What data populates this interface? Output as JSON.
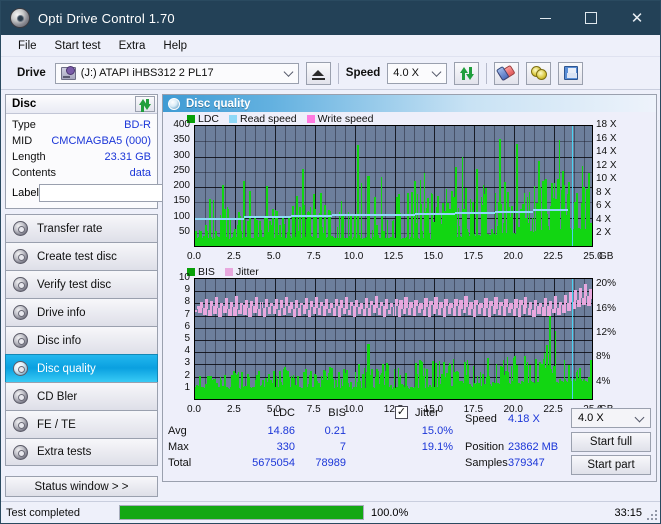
{
  "window": {
    "title": "Opti Drive Control 1.70",
    "icon": "disc-icon",
    "controls": {
      "minimize": "–",
      "maximize": "□",
      "close": "✕"
    }
  },
  "menu": {
    "items": [
      "File",
      "Start test",
      "Extra",
      "Help"
    ]
  },
  "toolbar": {
    "drive_label": "Drive",
    "drive_value": "(J:)   ATAPI iHBS312   2 PL17",
    "eject_icon": "eject-icon",
    "speed_label": "Speed",
    "speed_value": "4.0 X",
    "refresh_icon": "refresh-icon",
    "erase_icon": "eraser-icon",
    "discs_icon": "two-discs-icon",
    "save_icon": "floppy-save-icon"
  },
  "disc_panel": {
    "title": "Disc",
    "refresh_icon": "refresh-icon",
    "rows": [
      {
        "key": "Type",
        "value": "BD-R"
      },
      {
        "key": "MID",
        "value": "CMCMAGBA5 (000)"
      },
      {
        "key": "Length",
        "value": "23.31 GB"
      },
      {
        "key": "Contents",
        "value": "data"
      }
    ],
    "label_key": "Label",
    "label_value": "",
    "label_placeholder": "",
    "label_icon": "disc-label-icon"
  },
  "nav": {
    "items": [
      {
        "label": "Transfer rate",
        "selected": false
      },
      {
        "label": "Create test disc",
        "selected": false
      },
      {
        "label": "Verify test disc",
        "selected": false
      },
      {
        "label": "Drive info",
        "selected": false
      },
      {
        "label": "Disc info",
        "selected": false
      },
      {
        "label": "Disc quality",
        "selected": true
      },
      {
        "label": "CD Bler",
        "selected": false
      },
      {
        "label": "FE / TE",
        "selected": false
      },
      {
        "label": "Extra tests",
        "selected": false
      }
    ],
    "status_window": "Status window > >"
  },
  "main": {
    "header_title": "Disc quality",
    "header_icon": "disc-quality-icon"
  },
  "stats": {
    "col_headers": [
      "LDC",
      "BIS"
    ],
    "jitter_label": "Jitter",
    "jitter_checked": true,
    "rows": [
      {
        "name": "Avg",
        "ldc": "14.86",
        "bis": "0.21",
        "jitter": "15.0%"
      },
      {
        "name": "Max",
        "ldc": "330",
        "bis": "7",
        "jitter": "19.1%"
      },
      {
        "name": "Total",
        "ldc": "5675054",
        "bis": "78989",
        "jitter": ""
      }
    ],
    "speed_label": "Speed",
    "speed_value": "4.18 X",
    "position_label": "Position",
    "position_value": "23862 MB",
    "samples_label": "Samples",
    "samples_value": "379347",
    "speed_select": "4.0 X",
    "start_full": "Start full",
    "start_part": "Start part"
  },
  "statusbar": {
    "text": "Test completed",
    "percent": "100.0%",
    "progress": 100,
    "elapsed": "33:15",
    "progress_color": "#14a814"
  },
  "chart_data": [
    {
      "id": "top",
      "type": "bar",
      "title": "LDC / Read speed",
      "legend": [
        {
          "label": "LDC",
          "color": "#08a008"
        },
        {
          "label": "Read speed",
          "color": "#8fd8f7"
        },
        {
          "label": "Write speed",
          "color": "#ff7ae0"
        }
      ],
      "xlabel": "GB",
      "ylabel": "LDC",
      "y2label": "X",
      "xlim": [
        0,
        25.0
      ],
      "ylim": [
        0,
        400
      ],
      "y2lim": [
        0,
        18
      ],
      "xticks": [
        "0.0",
        "2.5",
        "5.0",
        "7.5",
        "10.0",
        "12.5",
        "15.0",
        "17.5",
        "20.0",
        "22.5",
        "25.0"
      ],
      "yticks": [
        "400",
        "350",
        "300",
        "250",
        "200",
        "150",
        "100",
        "50"
      ],
      "y2ticks": [
        "18 X",
        "16 X",
        "14 X",
        "12 X",
        "10 X",
        "8 X",
        "6 X",
        "4 X",
        "2 X"
      ],
      "x_unit_label": "GB",
      "grid": true,
      "series": [
        {
          "name": "LDC",
          "color": "#12d612",
          "baseline": [
            28,
            26,
            30,
            24,
            27,
            25,
            70,
            29,
            26,
            31,
            24,
            27,
            26,
            34,
            28,
            26,
            25,
            27,
            120,
            28,
            26,
            24,
            27,
            30,
            26,
            25,
            28,
            26,
            24,
            27,
            26,
            29,
            26,
            24,
            28,
            26,
            25,
            27,
            26,
            28,
            24,
            26,
            29,
            26,
            25,
            27,
            26,
            24,
            28,
            26,
            27,
            25,
            26,
            28,
            24,
            27,
            26,
            25,
            100,
            27,
            26,
            24,
            28,
            26,
            25,
            27,
            26,
            24,
            28,
            26,
            27,
            25,
            26,
            28,
            24,
            27,
            26,
            25,
            28,
            26,
            24,
            27,
            26,
            29,
            26,
            24,
            28,
            26,
            25,
            27,
            26,
            24,
            28,
            26,
            27,
            25,
            26,
            28,
            24,
            27,
            26,
            25,
            28,
            26,
            24,
            27,
            26,
            29,
            230,
            26,
            24,
            28,
            26,
            25,
            27,
            26,
            24,
            28,
            26,
            27,
            25,
            26,
            28,
            24,
            27,
            26,
            25,
            28,
            26,
            24,
            27,
            26,
            29,
            26,
            24,
            28,
            26,
            25,
            27,
            26,
            24,
            28,
            26,
            27,
            25,
            26,
            28,
            24,
            27,
            26,
            25,
            28,
            26,
            24,
            27,
            26,
            29,
            26,
            24,
            28,
            30,
            28,
            32,
            30,
            28,
            34,
            30,
            28,
            36,
            32,
            30,
            34,
            32,
            30,
            38,
            34,
            32,
            36,
            34,
            32,
            40,
            36,
            34,
            38,
            36,
            34,
            42,
            38,
            36,
            40,
            38,
            36,
            44,
            40,
            38,
            42,
            40,
            38,
            46,
            42,
            40,
            44,
            42,
            40,
            48,
            44,
            42,
            46,
            44,
            42,
            50,
            46,
            44,
            48,
            46,
            44,
            52,
            48,
            46,
            50,
            48,
            46,
            54,
            50,
            48,
            52,
            50,
            48,
            56,
            52,
            50,
            54,
            52,
            50,
            58,
            54,
            52,
            56,
            54,
            52,
            60,
            56,
            54,
            58,
            56,
            54,
            62,
            58,
            56,
            60
          ]
        },
        {
          "name": "Read speed",
          "color": "#8fd8f7",
          "steps": [
            {
              "x0": 0.0,
              "x1": 3.1,
              "v": 3.9
            },
            {
              "x0": 3.1,
              "x1": 6.0,
              "v": 4.1
            },
            {
              "x0": 6.0,
              "x1": 8.6,
              "v": 4.25
            },
            {
              "x0": 8.6,
              "x1": 11.2,
              "v": 4.4
            },
            {
              "x0": 11.2,
              "x1": 13.8,
              "v": 4.5
            },
            {
              "x0": 13.8,
              "x1": 16.3,
              "v": 4.6
            },
            {
              "x0": 16.3,
              "x1": 18.8,
              "v": 4.75
            },
            {
              "x0": 18.8,
              "x1": 21.2,
              "v": 4.9
            },
            {
              "x0": 21.2,
              "x1": 23.4,
              "v": 5.1
            }
          ]
        }
      ],
      "marker_line": {
        "x": 23.65,
        "color": "#49d3f2"
      }
    },
    {
      "id": "bottom",
      "type": "bar",
      "title": "BIS / Jitter",
      "legend": [
        {
          "label": "BIS",
          "color": "#08a008"
        },
        {
          "label": "Jitter",
          "color": "#e8a8de"
        }
      ],
      "xlabel": "GB",
      "ylabel": "BIS",
      "y2label": "%",
      "xlim": [
        0,
        25.0
      ],
      "ylim": [
        0,
        10
      ],
      "y2lim": [
        0,
        20
      ],
      "xticks": [
        "0.0",
        "2.5",
        "5.0",
        "7.5",
        "10.0",
        "12.5",
        "15.0",
        "17.5",
        "20.0",
        "22.5",
        "25.0"
      ],
      "yticks": [
        "10",
        "9",
        "8",
        "7",
        "6",
        "5",
        "4",
        "3",
        "2",
        "1"
      ],
      "y2ticks": [
        "20%",
        "16%",
        "12%",
        "8%",
        "4%"
      ],
      "x_unit_label": "GB",
      "grid": true,
      "series": [
        {
          "name": "BIS",
          "color": "#12d612",
          "avg": 0.21,
          "max": 7,
          "baseline": [
            1.0,
            0.9,
            1.1,
            0.8,
            1.0,
            0.9,
            1.2,
            1.0,
            0.9,
            1.1,
            0.8,
            1.0,
            0.9,
            1.3,
            1.0,
            0.9,
            1.0,
            1.1,
            2.0,
            1.0,
            0.9,
            0.8,
            1.0,
            1.1,
            0.9,
            1.0,
            1.0,
            0.9,
            0.8,
            1.0,
            1.0,
            1.1,
            0.9,
            0.8,
            1.0,
            0.9,
            1.0,
            1.0,
            0.9,
            1.0,
            0.8,
            0.9,
            1.1,
            1.0,
            0.9,
            1.0,
            0.9,
            0.8,
            1.0,
            0.9,
            1.0,
            0.9,
            1.0,
            1.0,
            0.8,
            1.0,
            0.9,
            1.0,
            1.8,
            1.0,
            0.9,
            0.8,
            1.0,
            0.9,
            1.0,
            1.0,
            0.9,
            0.8,
            1.0,
            0.9,
            1.0,
            0.9,
            1.0,
            1.0,
            0.8,
            1.0,
            0.9,
            1.0,
            1.0,
            0.9,
            0.8,
            1.0,
            0.9,
            1.1,
            0.9,
            0.8,
            1.0,
            0.9,
            1.0,
            1.0,
            0.9,
            0.8,
            1.0,
            0.9,
            1.0,
            0.9,
            1.0,
            1.0,
            0.8,
            1.0,
            0.9,
            1.0,
            1.0,
            0.9,
            0.8,
            1.0,
            0.9,
            1.1,
            4.5,
            0.9,
            0.8,
            1.0,
            0.9,
            1.0,
            1.0,
            0.9,
            0.8,
            1.0,
            0.9,
            1.0,
            0.9,
            1.0,
            1.0,
            0.8,
            1.0,
            0.9,
            1.0,
            1.0,
            0.9,
            0.8,
            1.0,
            0.9,
            1.1,
            0.9,
            0.8,
            1.0,
            0.9,
            1.0,
            1.0,
            0.9,
            0.8,
            1.0,
            0.9,
            1.0,
            0.9,
            1.0,
            1.0,
            0.8,
            1.0,
            0.9,
            1.0,
            1.0,
            0.9,
            0.8,
            1.0,
            0.9,
            1.1,
            0.9,
            0.8,
            1.0,
            1.1,
            1.0,
            1.2,
            1.1,
            1.0,
            1.2,
            1.1,
            1.0,
            1.3,
            1.2,
            1.1,
            1.2,
            1.1,
            1.0,
            1.3,
            1.2,
            1.1,
            1.3,
            1.2,
            1.1,
            1.4,
            1.2,
            1.1,
            1.3,
            1.2,
            1.1,
            1.4,
            1.3,
            1.2,
            1.3,
            1.2,
            1.1,
            1.4,
            1.3,
            1.2,
            1.4,
            1.3,
            1.2,
            1.5,
            1.3,
            1.2,
            1.4,
            1.3,
            1.2,
            1.5,
            1.4,
            1.3,
            1.4,
            1.3,
            1.2,
            1.5,
            1.4,
            1.3,
            1.5,
            1.4,
            1.3,
            1.6,
            1.4,
            1.3,
            1.5,
            1.4,
            1.3,
            1.6,
            1.5,
            1.4,
            1.5,
            1.4,
            1.3,
            1.6,
            1.5,
            1.4,
            1.6,
            1.5,
            1.4,
            1.7,
            1.5,
            1.4,
            1.6,
            1.5,
            1.4,
            1.7,
            1.6,
            1.5,
            1.6,
            1.5,
            1.4,
            1.7,
            1.6,
            1.5,
            1.7
          ]
        },
        {
          "name": "Jitter",
          "color": "#e8a8de",
          "avg_pct": 15.0,
          "max_pct": 19.1,
          "values_pct": [
            15.0,
            15.6,
            14.4,
            16.2,
            15.3,
            14.1,
            16.8,
            15.0,
            13.9,
            16.4,
            15.5,
            14.2,
            17.1,
            15.2,
            13.8,
            16.0,
            15.6,
            14.5,
            16.9,
            15.1,
            14.0,
            16.3,
            15.4,
            13.9,
            17.2,
            15.0,
            14.3,
            16.1,
            15.7,
            14.1,
            16.6,
            15.2,
            13.7,
            16.4,
            15.5,
            14.4,
            17.0,
            15.1,
            14.0,
            16.2,
            15.3,
            13.8,
            16.7,
            15.4,
            14.2,
            16.0,
            15.6,
            14.3,
            16.8,
            15.0,
            13.9,
            16.5,
            15.2,
            14.1,
            17.1,
            15.5,
            14.4,
            16.3,
            15.1,
            13.8,
            16.6,
            15.3,
            14.0,
            16.1,
            15.7,
            14.2,
            16.9,
            15.0,
            13.7,
            16.4,
            15.4,
            14.3,
            17.0,
            15.2,
            14.1,
            16.2,
            15.6,
            13.9,
            16.7,
            15.1,
            14.4,
            16.0,
            15.3,
            14.0,
            16.8,
            15.5,
            13.8,
            16.5,
            15.2,
            14.2,
            17.1,
            15.0,
            14.1,
            16.3,
            15.6,
            13.7,
            16.6,
            15.4,
            14.3,
            16.1,
            15.1,
            14.0,
            16.9,
            15.3,
            13.9,
            16.4,
            15.7,
            14.4,
            17.2,
            15.2,
            14.1,
            16.2,
            15.5,
            13.8,
            16.7,
            15.0,
            14.2,
            16.0,
            15.4,
            14.0,
            16.8,
            15.6,
            13.7,
            16.5,
            15.1,
            14.3,
            17.0,
            15.3,
            14.1,
            16.3,
            15.2,
            13.9,
            16.6,
            15.5,
            14.4,
            16.1,
            15.0,
            14.0,
            16.9,
            15.4,
            13.8,
            16.4,
            15.7,
            14.2,
            17.1,
            15.1,
            14.1,
            16.2,
            15.3,
            13.7,
            16.7,
            15.6,
            14.3,
            16.0,
            15.2,
            14.0,
            16.8,
            15.5,
            13.9,
            16.5,
            15.0,
            14.4,
            17.2,
            15.4,
            14.1,
            16.3,
            15.1,
            13.8,
            16.6,
            15.7,
            14.2,
            16.1,
            15.3,
            14.0,
            16.9,
            15.2,
            13.7,
            16.4,
            15.6,
            14.3,
            17.0,
            15.0,
            14.1,
            16.2,
            15.5,
            13.9,
            16.7,
            15.4,
            14.4,
            16.0,
            15.1,
            14.0,
            16.8,
            15.3,
            13.8,
            16.5,
            15.7,
            14.2,
            17.1,
            15.2,
            14.1,
            16.3,
            15.0,
            13.7,
            16.6,
            15.6,
            14.3,
            16.1,
            15.4,
            14.0,
            16.9,
            15.5,
            13.9,
            16.4,
            15.1,
            14.4,
            17.2,
            15.3,
            14.1,
            16.2,
            15.7,
            14.5,
            17.4,
            16.0,
            14.8,
            17.8,
            16.3,
            15.1,
            18.2,
            16.6,
            15.4,
            18.6,
            16.9,
            15.8,
            19.1,
            17.2,
            15.6,
            18.4,
            16.8,
            15.9
          ]
        }
      ],
      "marker_line": {
        "x": 23.65,
        "color": "#49d3f2"
      }
    }
  ]
}
